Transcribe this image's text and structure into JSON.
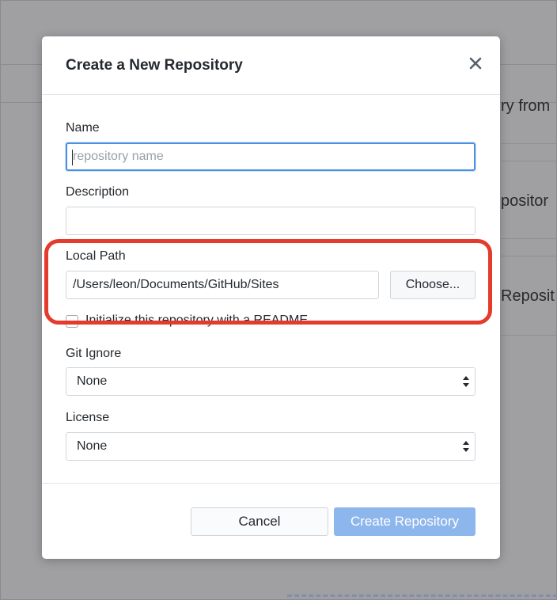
{
  "background": {
    "rows": [
      {
        "label": "ry from"
      },
      {
        "label": "positor"
      },
      {
        "label": "Reposit"
      }
    ]
  },
  "dialog": {
    "title": "Create a New Repository",
    "close_icon": "close-icon",
    "name": {
      "label": "Name",
      "value": "",
      "placeholder": "repository name"
    },
    "description": {
      "label": "Description",
      "value": ""
    },
    "local_path": {
      "label": "Local Path",
      "value": "/Users/leon/Documents/GitHub/Sites",
      "choose_label": "Choose..."
    },
    "readme": {
      "label": "Initialize this repository with a README",
      "checked": false
    },
    "git_ignore": {
      "label": "Git Ignore",
      "selected": "None"
    },
    "license": {
      "label": "License",
      "selected": "None"
    },
    "footer": {
      "cancel_label": "Cancel",
      "create_label": "Create Repository"
    }
  },
  "colors": {
    "accent": "#4a90e2",
    "create_button": "#8db6ec",
    "highlight": "#e53b2c",
    "overlay": "#a0a0a3"
  }
}
